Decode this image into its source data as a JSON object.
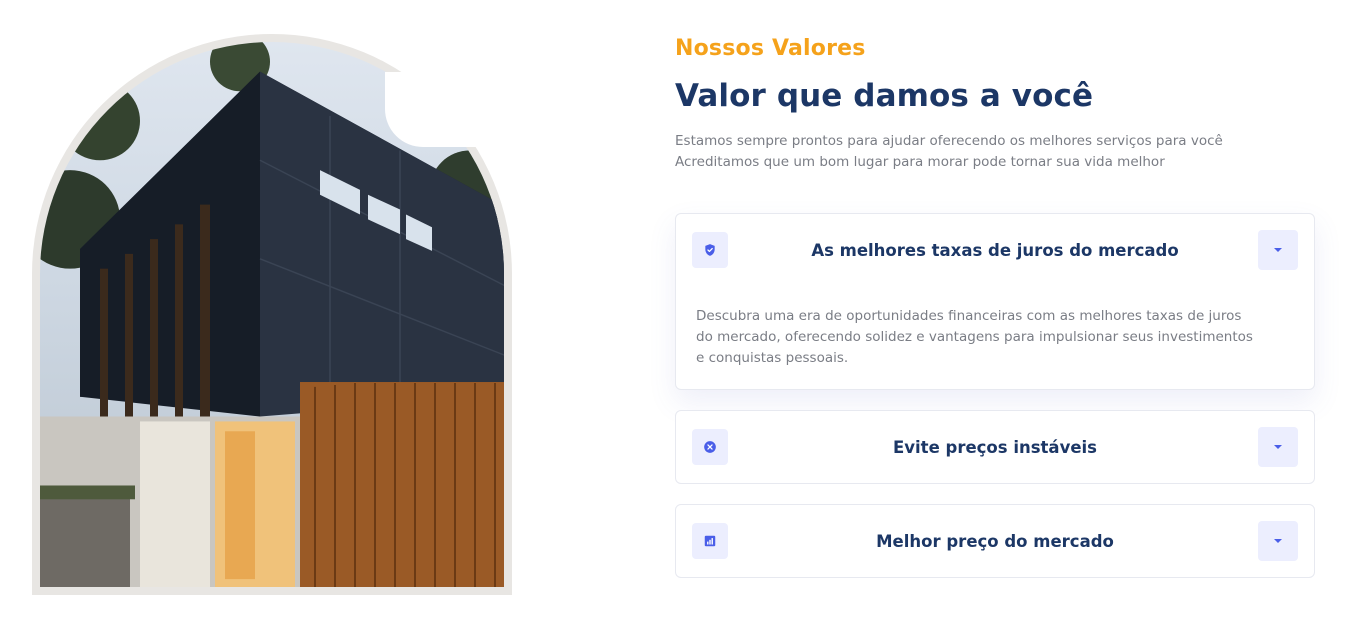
{
  "section": {
    "eyebrow": "Nossos Valores",
    "title": "Valor que damos a você",
    "description_lines": [
      "Estamos sempre prontos para ajudar oferecendo os melhores serviços para você",
      "Acreditamos que um bom lugar para morar pode tornar sua vida melhor"
    ]
  },
  "accordion": [
    {
      "title": "As melhores taxas de juros do mercado",
      "icon": "shield-check-icon",
      "expanded": true,
      "body_lines": [
        "Descubra uma era de oportunidades financeiras com as melhores taxas de juros",
        "do mercado, oferecendo solidez e vantagens para impulsionar seus investimentos",
        "e conquistas pessoais."
      ]
    },
    {
      "title": "Evite preços instáveis",
      "icon": "x-circle-icon",
      "expanded": false
    },
    {
      "title": "Melhor preço do mercado",
      "icon": "bar-chart-icon",
      "expanded": false
    }
  ],
  "colors": {
    "accent": "#f5a21b",
    "heading": "#1c3766",
    "icon": "#4a5ee8",
    "icon_bg": "#eceefe",
    "text_muted": "#7a7d85"
  }
}
